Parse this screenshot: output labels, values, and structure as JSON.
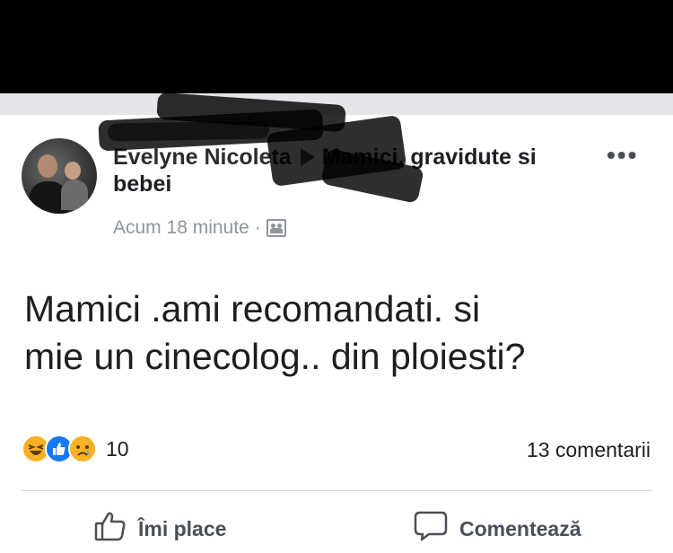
{
  "post": {
    "author": "Evelyne Nicoleta",
    "group": "Mamici, gravidute si bebei",
    "time": "Acum 18 minute",
    "more_glyph": "•••",
    "message_line1": "Mamici .ami recomandati. si",
    "message_line2": "mie un cinecolog.. din ploiesti?"
  },
  "reactions": {
    "icons": [
      "haha-icon",
      "like-icon",
      "sad-icon"
    ],
    "count": "10"
  },
  "comments_label": "13 comentarii",
  "actions": {
    "like_label": "Îmi place",
    "comment_label": "Comentează"
  },
  "colors": {
    "like_blue": "#1877f2",
    "emoji_yellow": "#f7b125",
    "muted": "#90949c",
    "action_text": "#4b4f56"
  }
}
